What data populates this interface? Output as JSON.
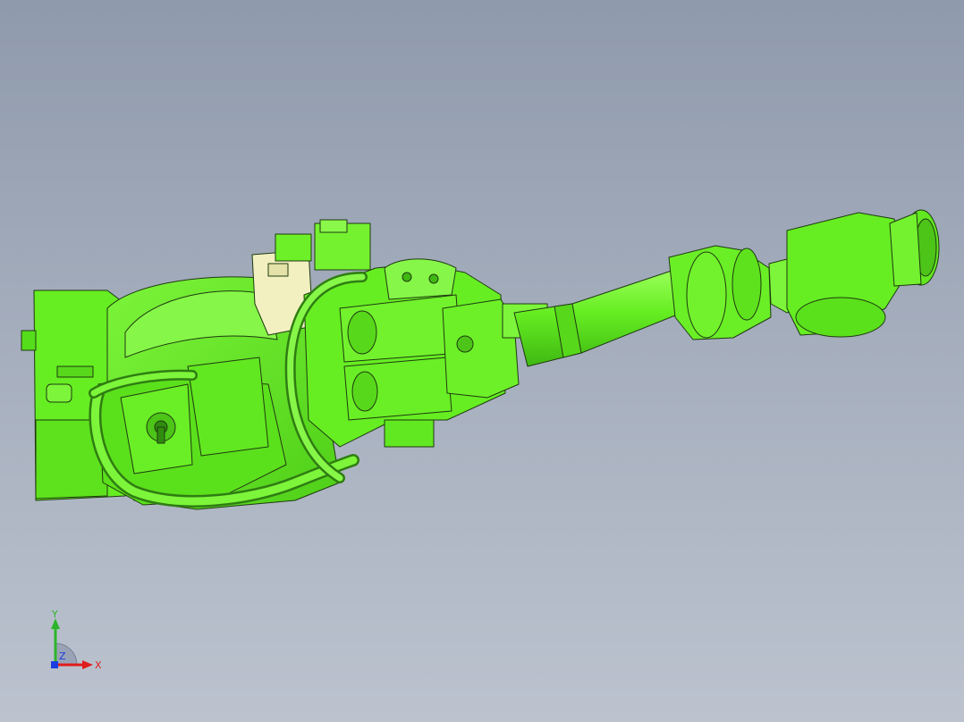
{
  "colors": {
    "background_top": "#8f9aac",
    "background_bottom": "#bcc3cf",
    "model_fill": "#66ee22",
    "model_shadow": "#3fb812",
    "model_highlight": "#9dff5c",
    "edge_line": "#1f3a10",
    "bracket_fill": "#f2f0c0",
    "axis_x": "#e01c1c",
    "axis_y": "#2bb52b",
    "axis_z": "#1b3de0"
  },
  "coordinate_triad": {
    "icon": "xyz-axis-triad-icon",
    "x_label": "X",
    "y_label": "Y",
    "z_label": "Z"
  },
  "model": {
    "icon": "robot-arm-3d-model"
  }
}
